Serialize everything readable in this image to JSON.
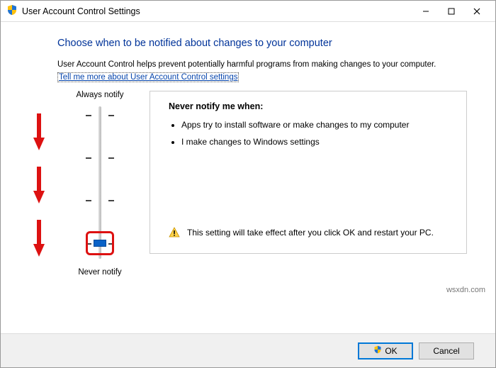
{
  "window": {
    "title": "User Account Control Settings"
  },
  "heading": "Choose when to be notified about changes to your computer",
  "description": "User Account Control helps prevent potentially harmful programs from making changes to your computer.",
  "help_link": "Tell me more about User Account Control settings",
  "slider": {
    "top_label": "Always notify",
    "bottom_label": "Never notify"
  },
  "panel": {
    "title": "Never notify me when:",
    "bullets": [
      "Apps try to install software or make changes to my computer",
      "I make changes to Windows settings"
    ],
    "warning": "This setting will take effect after you click OK and restart your PC."
  },
  "buttons": {
    "ok": "OK",
    "cancel": "Cancel"
  },
  "watermark": "wsxdn.com"
}
